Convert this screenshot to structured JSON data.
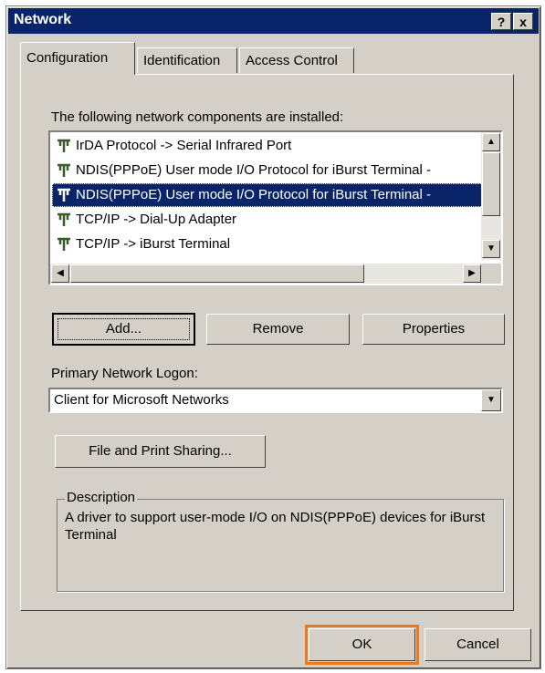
{
  "window": {
    "title": "Network",
    "help_button": "?",
    "close_button": "x"
  },
  "tabs": [
    {
      "label": "Configuration",
      "active": true
    },
    {
      "label": "Identification",
      "active": false
    },
    {
      "label": "Access Control",
      "active": false
    }
  ],
  "components": {
    "label": "The following network components are installed:",
    "items": [
      {
        "icon": "network-protocol-icon",
        "label": "IrDA Protocol -> Serial Infrared Port",
        "selected": false
      },
      {
        "icon": "network-protocol-icon",
        "label": "NDIS(PPPoE) User mode I/O Protocol for iBurst Terminal -",
        "selected": false
      },
      {
        "icon": "network-protocol-icon",
        "label": "NDIS(PPPoE) User mode I/O Protocol for iBurst Terminal -",
        "selected": true
      },
      {
        "icon": "network-protocol-icon",
        "label": "TCP/IP -> Dial-Up Adapter",
        "selected": false
      },
      {
        "icon": "network-protocol-icon",
        "label": "TCP/IP -> iBurst Terminal",
        "selected": false
      }
    ]
  },
  "buttons": {
    "add": "Add...",
    "remove": "Remove",
    "properties": "Properties",
    "file_print": "File and Print Sharing...",
    "ok": "OK",
    "cancel": "Cancel"
  },
  "logon": {
    "label": "Primary Network Logon:",
    "value": "Client for Microsoft Networks"
  },
  "description": {
    "label": "Description",
    "text": "A driver to support user-mode I/O on NDIS(PPPoE) devices for iBurst Terminal"
  },
  "colors": {
    "selection": "#0a246a",
    "highlight": "#f07a1a",
    "face": "#d4d0c8"
  }
}
